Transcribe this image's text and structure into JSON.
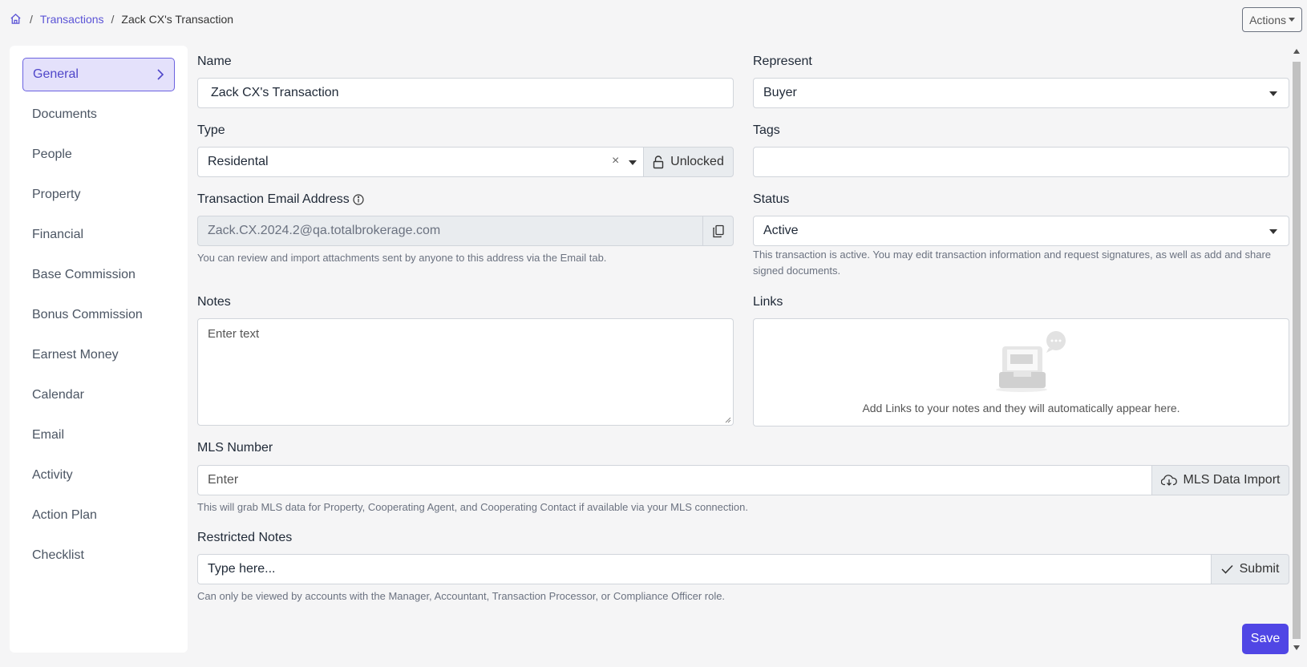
{
  "breadcrumb": {
    "parent": "Transactions",
    "current": "Zack CX's Transaction",
    "separator": "/"
  },
  "header": {
    "actions_label": "Actions"
  },
  "sidebar": {
    "items": [
      {
        "label": "General"
      },
      {
        "label": "Documents"
      },
      {
        "label": "People"
      },
      {
        "label": "Property"
      },
      {
        "label": "Financial"
      },
      {
        "label": "Base Commission"
      },
      {
        "label": "Bonus Commission"
      },
      {
        "label": "Earnest Money"
      },
      {
        "label": "Calendar"
      },
      {
        "label": "Email"
      },
      {
        "label": "Activity"
      },
      {
        "label": "Action Plan"
      },
      {
        "label": "Checklist"
      }
    ]
  },
  "form": {
    "name": {
      "label": "Name",
      "value": "Zack CX's Transaction"
    },
    "represent": {
      "label": "Represent",
      "value": "Buyer"
    },
    "type": {
      "label": "Type",
      "value": "Residental",
      "clear": "×",
      "lock_label": "Unlocked"
    },
    "tags": {
      "label": "Tags",
      "value": ""
    },
    "email": {
      "label": "Transaction Email Address",
      "value": "Zack.CX.2024.2@qa.totalbrokerage.com",
      "help": "You can review and import attachments sent by anyone to this address via the Email tab."
    },
    "status": {
      "label": "Status",
      "value": "Active",
      "help": "This transaction is active. You may edit transaction information and request signatures, as well as add and share signed documents."
    },
    "notes": {
      "label": "Notes",
      "placeholder": "Enter text"
    },
    "links": {
      "label": "Links",
      "empty_text": "Add Links to your notes and they will automatically appear here."
    },
    "mls": {
      "label": "MLS Number",
      "placeholder": "Enter",
      "import_label": "MLS Data Import",
      "help": "This will grab MLS data for Property, Cooperating Agent, and Cooperating Contact if available via your MLS connection."
    },
    "restricted": {
      "label": "Restricted Notes",
      "placeholder": "Type here...",
      "submit_label": "Submit",
      "help": "Can only be viewed by accounts with the Manager, Accountant, Transaction Processor, or Compliance Officer role."
    },
    "save_label": "Save"
  },
  "colors": {
    "accent": "#5046e5",
    "active_bg": "#e4e1fb"
  }
}
